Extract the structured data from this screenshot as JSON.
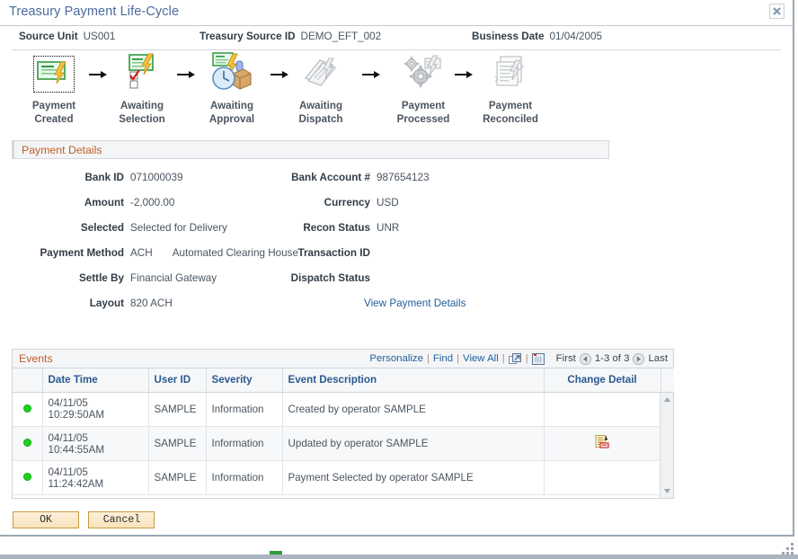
{
  "dialog": {
    "title": "Treasury Payment Life-Cycle",
    "close_icon": "close-icon"
  },
  "key_fields": [
    {
      "label": "Source Unit",
      "value": "US001"
    },
    {
      "label": "Treasury Source ID",
      "value": "DEMO_EFT_002"
    },
    {
      "label": "Business Date",
      "value": "01/04/2005"
    }
  ],
  "lifecycle": {
    "steps": [
      {
        "line1": "Payment",
        "line2": "Created",
        "icon": "check-payment-icon",
        "state": "current"
      },
      {
        "line1": "Awaiting",
        "line2": "Selection",
        "icon": "payment-selection-icon",
        "state": "active"
      },
      {
        "line1": "Awaiting",
        "line2": "Approval",
        "icon": "approval-clock-icon",
        "state": "active"
      },
      {
        "line1": "Awaiting",
        "line2": "Dispatch",
        "icon": "dispatch-icon",
        "state": "inactive"
      },
      {
        "line1": "Payment",
        "line2": "Processed",
        "icon": "gears-processed-icon",
        "state": "inactive"
      },
      {
        "line1": "Payment",
        "line2": "Reconciled",
        "icon": "reconciled-doc-icon",
        "state": "inactive"
      }
    ],
    "arrow_icon": "arrow-right-icon"
  },
  "payment_details": {
    "section_title": "Payment Details",
    "left": [
      {
        "label": "Bank ID",
        "value": "071000039",
        "extra": ""
      },
      {
        "label": "Amount",
        "value": "-2,000.00",
        "extra": ""
      },
      {
        "label": "Selected",
        "value": "Selected for Delivery",
        "extra": ""
      },
      {
        "label": "Payment Method",
        "value": "ACH",
        "extra": "Automated Clearing House"
      },
      {
        "label": "Settle By",
        "value": "Financial Gateway",
        "extra": ""
      },
      {
        "label": "Layout",
        "value": "820 ACH",
        "extra": ""
      }
    ],
    "right": [
      {
        "label": "Bank Account #",
        "value": "987654123"
      },
      {
        "label": "Currency",
        "value": "USD"
      },
      {
        "label": "Recon Status",
        "value": "UNR"
      },
      {
        "label": "Transaction ID",
        "value": ""
      },
      {
        "label": "Dispatch Status",
        "value": ""
      }
    ],
    "view_link": "View Payment Details"
  },
  "events": {
    "section_title": "Events",
    "toolbar": {
      "personalize": "Personalize",
      "find": "Find",
      "view_all": "View All",
      "expand_icon": "expand-grid-icon",
      "download_icon": "download-spreadsheet-icon",
      "first": "First",
      "prev_icon": "prev-page-icon",
      "range": "1-3 of 3",
      "next_icon": "next-page-icon",
      "last": "Last"
    },
    "columns": [
      "",
      "Date Time",
      "User ID",
      "Severity",
      "Event Description",
      "Change Detail"
    ],
    "rows": [
      {
        "status_icon": "green-status-dot",
        "date_time": "04/11/05 10:29:50AM",
        "user_id": "SAMPLE",
        "severity": "Information",
        "description": "Created by operator SAMPLE",
        "change_detail_icon": ""
      },
      {
        "status_icon": "green-status-dot",
        "date_time": "04/11/05 10:44:55AM",
        "user_id": "SAMPLE",
        "severity": "Information",
        "description": "Updated by operator SAMPLE",
        "change_detail_icon": "change-detail-icon"
      },
      {
        "status_icon": "green-status-dot",
        "date_time": "04/11/05 11:24:42AM",
        "user_id": "SAMPLE",
        "severity": "Information",
        "description": "Payment Selected by operator SAMPLE",
        "change_detail_icon": ""
      }
    ]
  },
  "buttons": {
    "ok": "OK",
    "cancel": "Cancel"
  },
  "colors": {
    "title_blue": "#4b6a9b",
    "section_orange": "#c06024",
    "link_blue": "#21609b",
    "header_blue": "#2a5a92",
    "status_green": "#1fd11f",
    "button_gold": "#c99a45"
  }
}
